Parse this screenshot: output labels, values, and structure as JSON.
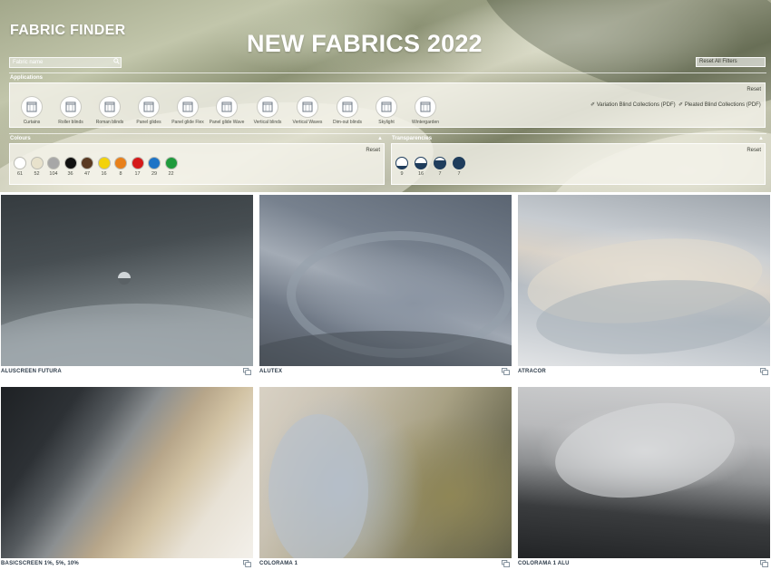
{
  "header": {
    "logo": "FABRIC FINDER",
    "headline": "NEW FABRICS 2022",
    "search_placeholder": "Fabric name",
    "reset_all_label": "Reset All Filters"
  },
  "applications": {
    "title": "Applications",
    "reset_label": "Reset",
    "items": [
      {
        "label": "Curtains",
        "icon": "curtains-icon"
      },
      {
        "label": "Roller blinds",
        "icon": "roller-blind-icon"
      },
      {
        "label": "Roman blinds",
        "icon": "roman-blind-icon"
      },
      {
        "label": "Panel glides",
        "icon": "panel-glide-icon"
      },
      {
        "label": "Panel glide Flex",
        "icon": "panel-glide-flex-icon"
      },
      {
        "label": "Panel glide Wave",
        "icon": "panel-glide-wave-icon"
      },
      {
        "label": "Vertical blinds",
        "icon": "vertical-blind-icon"
      },
      {
        "label": "Vertical Waves",
        "icon": "vertical-waves-icon"
      },
      {
        "label": "Dim-out blinds",
        "icon": "dim-out-blind-icon"
      },
      {
        "label": "Skylight",
        "icon": "skylight-icon"
      },
      {
        "label": "Wintergarden",
        "icon": "wintergarden-icon"
      }
    ],
    "pdf_links": [
      "Variation Blind Collections (PDF)",
      "Pleated Blind Collections (PDF)"
    ]
  },
  "colours": {
    "title": "Colours",
    "reset_label": "Reset",
    "swatches": [
      {
        "color": "#ffffff",
        "count": "61"
      },
      {
        "color": "#e8e2cc",
        "count": "52"
      },
      {
        "color": "#a7a7a7",
        "count": "104"
      },
      {
        "color": "#111111",
        "count": "36"
      },
      {
        "color": "#5a3a22",
        "count": "47"
      },
      {
        "color": "#f3d20a",
        "count": "16"
      },
      {
        "color": "#e8801a",
        "count": "8"
      },
      {
        "color": "#d51a1a",
        "count": "17"
      },
      {
        "color": "#1e74c6",
        "count": "29"
      },
      {
        "color": "#1f9a3c",
        "count": "22"
      }
    ]
  },
  "transparencies": {
    "title": "Transparencies",
    "reset_label": "Reset",
    "items": [
      {
        "count": "9",
        "fill": 0.25
      },
      {
        "count": "16",
        "fill": 0.5
      },
      {
        "count": "7",
        "fill": 0.75
      },
      {
        "count": "7",
        "fill": 1.0
      }
    ]
  },
  "fabrics": [
    {
      "name": "ALUSCREEN FUTURA"
    },
    {
      "name": "ALUTEX"
    },
    {
      "name": "ATRACOR"
    },
    {
      "name": "BASICSCREEN 1%, 5%, 10%"
    },
    {
      "name": "COLORAMA 1"
    },
    {
      "name": "COLORAMA 1 ALU"
    }
  ]
}
